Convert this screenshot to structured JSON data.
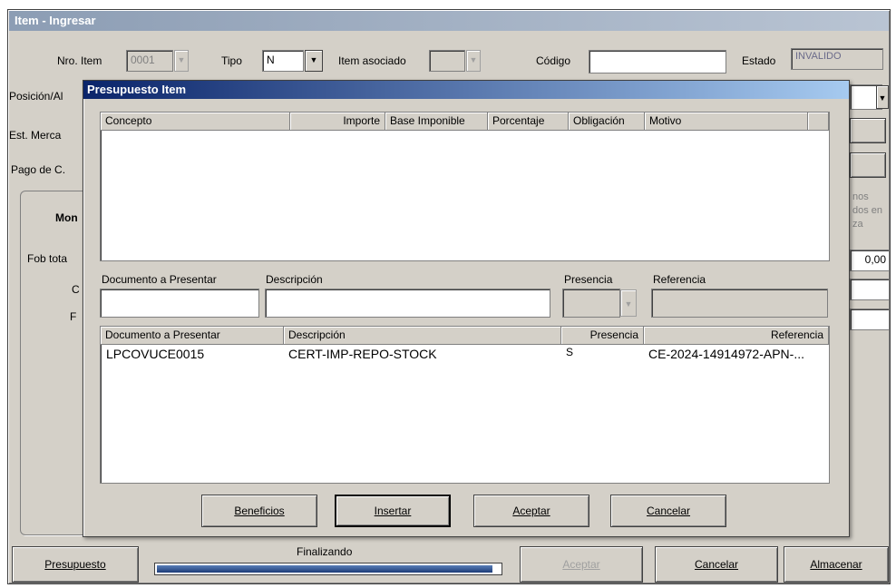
{
  "window": {
    "title": "Item - Ingresar"
  },
  "item_form": {
    "nro_item_label": "Nro. Item",
    "nro_item_value": "0001",
    "tipo_label": "Tipo",
    "tipo_value": "N",
    "item_asociado_label": "Item asociado",
    "codigo_label": "Código",
    "codigo_value": "",
    "estado_label": "Estado",
    "estado_value": "INVALIDO",
    "posicion_label": "Posición/Al",
    "est_merca_label": "Est. Merca",
    "pago_label": "Pago de C.",
    "group_label": "Mon",
    "fob_label": "Fob tota",
    "row_c_label": "C",
    "row_f_label": "F",
    "right_group_fragment": "nos\ndos en\nza",
    "fob_value": "0,00"
  },
  "modal": {
    "title": "Presupuesto Item",
    "grid1_columns": [
      "Concepto",
      "Importe",
      "Base Imponible",
      "Porcentaje",
      "Obligación",
      "Motivo"
    ],
    "doc_label": "Documento a Presentar",
    "desc_label": "Descripción",
    "presencia_label": "Presencia",
    "referencia_label": "Referencia",
    "doc_value": "",
    "desc_value": "",
    "grid2_columns": [
      "Documento a Presentar",
      "Descripción",
      "Presencia",
      "Referencia"
    ],
    "grid2_rows": [
      {
        "documento": "LPCOVUCE0015",
        "descripcion": "CERT-IMP-REPO-STOCK",
        "presencia": "S",
        "referencia": "CE-2024-14914972-APN-..."
      }
    ],
    "buttons": {
      "beneficios": "Beneficios",
      "insertar": "Insertar",
      "aceptar": "Aceptar",
      "cancelar": "Cancelar"
    }
  },
  "footer": {
    "presupuesto": "Presupuesto",
    "status": "Finalizando",
    "progress": 0.98,
    "aceptar": "Aceptar",
    "cancelar": "Cancelar",
    "almacenar": "Almacenar"
  }
}
